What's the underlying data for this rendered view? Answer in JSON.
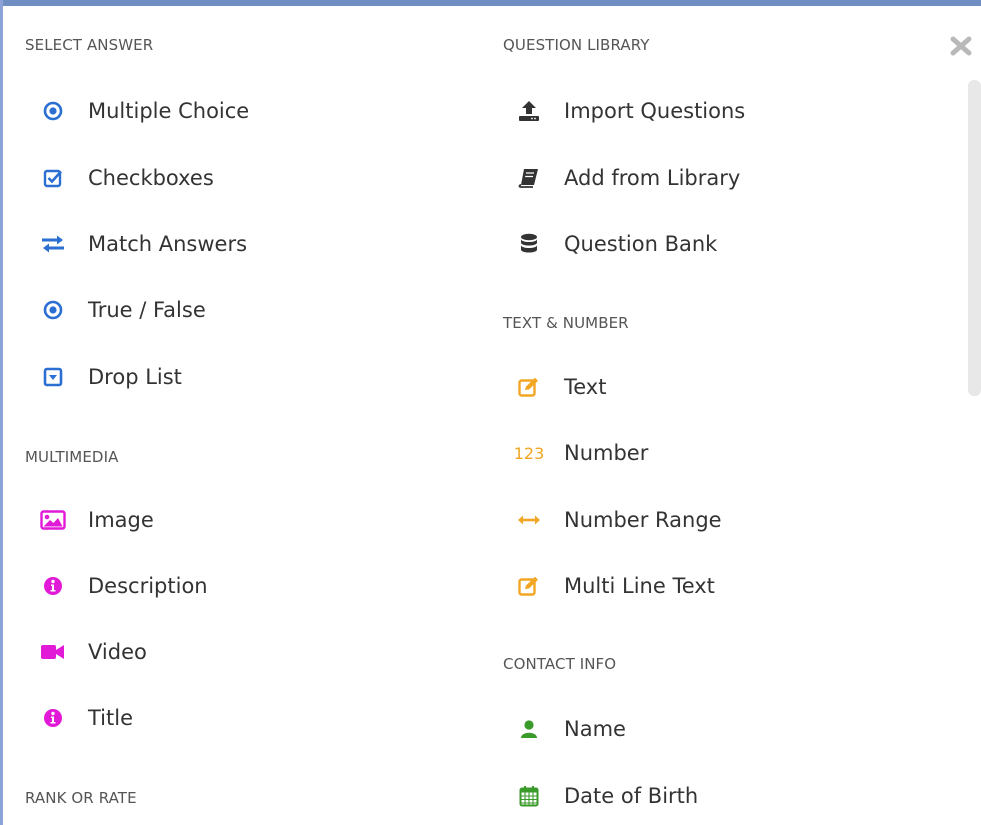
{
  "sections": {
    "select_answer": "SELECT ANSWER",
    "multimedia": "MULTIMEDIA",
    "rank_or_rate": "RANK OR RATE",
    "question_library": "QUESTION LIBRARY",
    "text_number": "TEXT & NUMBER",
    "contact_info": "CONTACT INFO"
  },
  "select_answer_items": [
    {
      "label": "Multiple Choice",
      "icon": "radio-dot-icon"
    },
    {
      "label": "Checkboxes",
      "icon": "checkbox-icon"
    },
    {
      "label": "Match Answers",
      "icon": "exchange-arrows-icon"
    },
    {
      "label": "True / False",
      "icon": "radio-dot-icon"
    },
    {
      "label": "Drop List",
      "icon": "dropdown-box-icon"
    }
  ],
  "multimedia_items": [
    {
      "label": "Image",
      "icon": "image-icon"
    },
    {
      "label": "Description",
      "icon": "info-icon"
    },
    {
      "label": "Video",
      "icon": "video-camera-icon"
    },
    {
      "label": "Title",
      "icon": "info-icon"
    }
  ],
  "question_library_items": [
    {
      "label": "Import Questions",
      "icon": "upload-icon"
    },
    {
      "label": "Add from Library",
      "icon": "book-icon"
    },
    {
      "label": "Question Bank",
      "icon": "database-icon"
    }
  ],
  "text_number_items": [
    {
      "label": "Text",
      "icon": "edit-square-icon"
    },
    {
      "label": "Number",
      "icon": "number-123-icon",
      "icon_text": "123"
    },
    {
      "label": "Number Range",
      "icon": "horizontal-arrows-icon"
    },
    {
      "label": "Multi Line Text",
      "icon": "edit-square-icon"
    }
  ],
  "contact_info_items": [
    {
      "label": "Name",
      "icon": "user-icon"
    },
    {
      "label": "Date of Birth",
      "icon": "calendar-icon"
    }
  ],
  "colors": {
    "blue": "#2a6fd1",
    "magenta": "#e11ad8",
    "orange": "#f2a623",
    "green": "#3a9a2a",
    "dark": "#333333"
  }
}
